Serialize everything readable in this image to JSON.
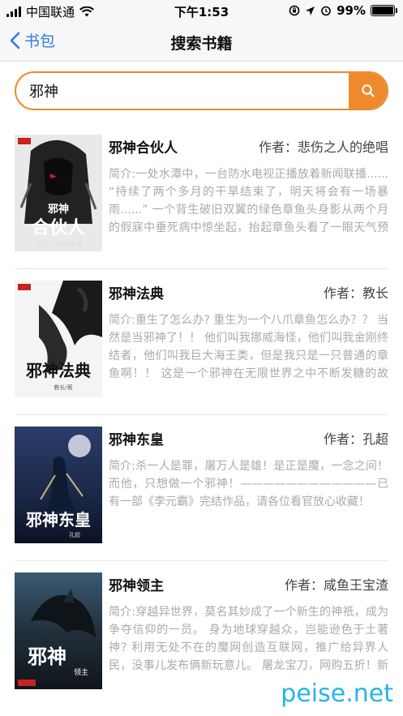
{
  "status_bar": {
    "carrier": "中国联通",
    "time": "下午1:53",
    "battery": "99%",
    "battery_level": 0.99
  },
  "nav": {
    "back_label": "书包",
    "title": "搜索书籍"
  },
  "search": {
    "query": "邪神"
  },
  "books": [
    {
      "title": "邪神合伙人",
      "author": "作者：悲伤之人的绝唱",
      "desc": "简介:一处水潭中，一台防水电视正播放着新闻联播......    “持续了两个多月的干旱结束了，明天将会有一场暴雨......”    一个背生破旧双翼的绿色章鱼头身影从两个月的假寐中垂死病中惊坐起，抬起章鱼头看了一眼天气预报。   ..."
    },
    {
      "title": "邪神法典",
      "author": "作者：教长",
      "desc": "简介:重生了怎么办?    重生为一个八爪章鱼怎么办？？    当然是当邪神了！！    他们叫我挪威海怪，他们叫我金刚终结者，他们叫我巨大海王类，但是我只是一只普通的章鱼啊！！ 这是一个邪神在无限世界之中不断发糖的故事..."
    },
    {
      "title": "邪神东皇",
      "author": "作者：孔超",
      "desc": "简介:杀一人是罪，屠万人是雄！是正是魔，一念之间！而他，只想做一个邪神！————————————已有一部《李元霸》完结作品，请各位看官放心收藏！"
    },
    {
      "title": "邪神领主",
      "author": "作者：咸鱼王宝渣",
      "desc": "简介:穿越异世界，莫名其妙成了一个新生的神祇，成为争夺信仰的一员。    身为地球穿越众，岂能逊色于土著神?    利用无处不在的魔网创造互联网，推广给异界人民，没事儿发布俩新玩意儿。    屠龙宝刀，网购五折！新番发..."
    }
  ],
  "cover_text": {
    "book1_title": "邪神合伙人",
    "book1_sub": "悲伤之人的绝唱/著",
    "book2_title": "邪神法典",
    "book2_sub": "教长/著",
    "book3_title": "邪神东皇",
    "book3_sub": "孔超",
    "book4_title": "邪神",
    "book4_sub": "领主"
  },
  "watermark": "peise.net",
  "colors": {
    "accent": "#ee8a2e",
    "link": "#2f7de1",
    "watermark": "#27b4e8"
  }
}
